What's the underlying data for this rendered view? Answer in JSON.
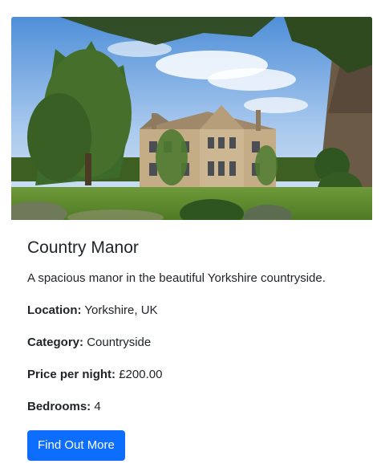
{
  "card": {
    "image_subject": "country manor house photo",
    "title": "Country Manor",
    "description": "A spacious manor in the beautiful Yorkshire countryside.",
    "details": [
      {
        "label": "Location:",
        "value": "Yorkshire, UK"
      },
      {
        "label": "Category:",
        "value": "Countryside"
      },
      {
        "label": "Price per night:",
        "value": "£200.00"
      },
      {
        "label": "Bedrooms:",
        "value": "4"
      }
    ],
    "button_label": "Find Out More",
    "accent_color": "#0d6efd"
  }
}
